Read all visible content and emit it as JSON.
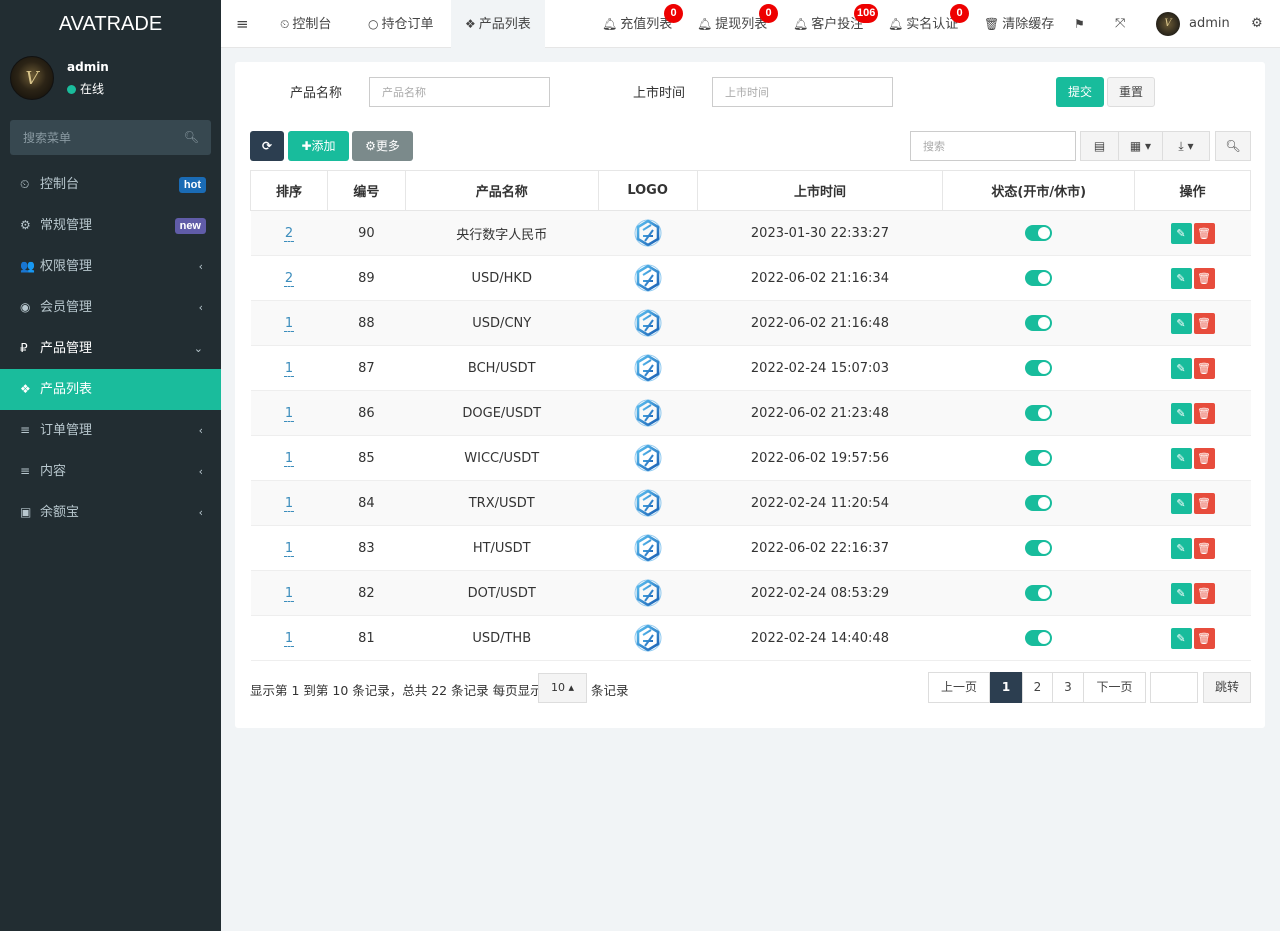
{
  "app": {
    "title": "AVATRADE"
  },
  "user": {
    "name": "admin",
    "status": "在线",
    "avatar_text": "V"
  },
  "sidebar": {
    "search_placeholder": "搜索菜单",
    "items": [
      {
        "label": "控制台",
        "icon": "dashboard-icon",
        "glyph": "⏲",
        "badge": "hot",
        "badge_color": "#1a6bb5"
      },
      {
        "label": "常规管理",
        "icon": "cogs-icon",
        "glyph": "⚙",
        "badge": "new",
        "badge_color": "#605ca8"
      },
      {
        "label": "权限管理",
        "icon": "group-icon",
        "glyph": "👥",
        "arrow": "‹"
      },
      {
        "label": "会员管理",
        "icon": "user-circle-icon",
        "glyph": "◉",
        "arrow": "‹"
      },
      {
        "label": "产品管理",
        "icon": "ruble-icon",
        "glyph": "₽",
        "arrow": "⌄"
      },
      {
        "label": "产品列表",
        "icon": "cubes-icon",
        "glyph": "❖",
        "active": true
      },
      {
        "label": "订单管理",
        "icon": "list-icon",
        "glyph": "≡",
        "arrow": "‹"
      },
      {
        "label": "内容",
        "icon": "list-icon",
        "glyph": "≡",
        "arrow": "‹"
      },
      {
        "label": "余额宝",
        "icon": "money-icon",
        "glyph": "▣",
        "arrow": "‹"
      }
    ]
  },
  "topbar": {
    "tabs": [
      {
        "label": "控制台",
        "icon": "dashboard-icon"
      },
      {
        "label": "持仓订单",
        "icon": "circle-icon"
      },
      {
        "label": "产品列表",
        "icon": "cubes-icon",
        "active": true
      }
    ],
    "notifications": [
      {
        "label": "充值列表",
        "count": "0"
      },
      {
        "label": "提现列表",
        "count": "0"
      },
      {
        "label": "客户投注",
        "count": "106"
      },
      {
        "label": "实名认证",
        "count": "0"
      }
    ],
    "clear_cache": "清除缓存",
    "admin_name": "admin"
  },
  "filter": {
    "name_label": "产品名称",
    "name_placeholder": "产品名称",
    "time_label": "上市时间",
    "time_placeholder": "上市时间",
    "submit": "提交",
    "reset": "重置"
  },
  "toolbar": {
    "add": "添加",
    "more": "更多",
    "search_placeholder": "搜索"
  },
  "table": {
    "columns": [
      "排序",
      "编号",
      "产品名称",
      "LOGO",
      "上市时间",
      "状态(开市/休市)",
      "操作"
    ],
    "rows": [
      {
        "sort": "2",
        "id": "90",
        "name": "央行数字人民币",
        "time": "2023-01-30 22:33:27",
        "status": true
      },
      {
        "sort": "2",
        "id": "89",
        "name": "USD/HKD",
        "time": "2022-06-02 21:16:34",
        "status": true
      },
      {
        "sort": "1",
        "id": "88",
        "name": "USD/CNY",
        "time": "2022-06-02 21:16:48",
        "status": true
      },
      {
        "sort": "1",
        "id": "87",
        "name": "BCH/USDT",
        "time": "2022-02-24 15:07:03",
        "status": true
      },
      {
        "sort": "1",
        "id": "86",
        "name": "DOGE/USDT",
        "time": "2022-06-02 21:23:48",
        "status": true
      },
      {
        "sort": "1",
        "id": "85",
        "name": "WICC/USDT",
        "time": "2022-06-02 19:57:56",
        "status": true
      },
      {
        "sort": "1",
        "id": "84",
        "name": "TRX/USDT",
        "time": "2022-02-24 11:20:54",
        "status": true
      },
      {
        "sort": "1",
        "id": "83",
        "name": "HT/USDT",
        "time": "2022-06-02 22:16:37",
        "status": true
      },
      {
        "sort": "1",
        "id": "82",
        "name": "DOT/USDT",
        "time": "2022-02-24 08:53:29",
        "status": true
      },
      {
        "sort": "1",
        "id": "81",
        "name": "USD/THB",
        "time": "2022-02-24 14:40:48",
        "status": true
      }
    ]
  },
  "pagination": {
    "info": "显示第 1 到第 10 条记录，总共 22 条记录 每页显示",
    "page_size": "10",
    "suffix": "条记录",
    "prev": "上一页",
    "pages": [
      "1",
      "2",
      "3"
    ],
    "next": "下一页",
    "jump": "跳转"
  },
  "colors": {
    "accent": "#18bc9c",
    "sidebar": "#222d32",
    "danger": "#e74c3c",
    "dark": "#2c3e50"
  }
}
